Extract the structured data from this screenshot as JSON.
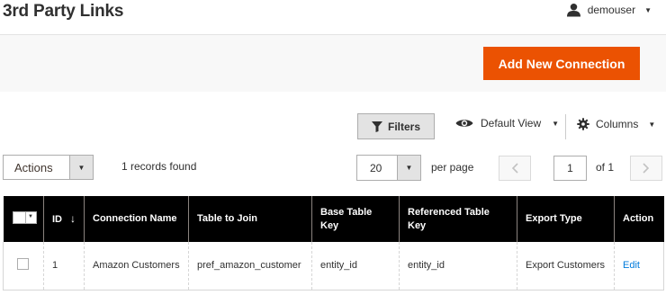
{
  "header": {
    "title": "3rd Party Links",
    "user_name": "demouser"
  },
  "action_bar": {
    "add_button": "Add New Connection"
  },
  "toolbar": {
    "filters_label": "Filters",
    "view_label": "Default View",
    "columns_label": "Columns"
  },
  "grid_controls": {
    "actions_label": "Actions",
    "records_found": "1 records found",
    "per_page_value": "20",
    "per_page_label": "per page",
    "current_page": "1",
    "total_pages": "of 1"
  },
  "table": {
    "columns": [
      "ID",
      "Connection Name",
      "Table to Join",
      "Base Table Key",
      "Referenced Table Key",
      "Export Type",
      "Action"
    ],
    "rows": [
      {
        "id": "1",
        "connection_name": "Amazon Customers",
        "table_to_join": "pref_amazon_customer",
        "base_key": "entity_id",
        "referenced_key": "entity_id",
        "export_type": "Export Customers",
        "action": "Edit"
      }
    ]
  },
  "colors": {
    "accent": "#eb5202",
    "header_bg": "#000000",
    "link": "#007bdb"
  },
  "icons": [
    "user-icon",
    "filter-icon",
    "eye-icon",
    "gear-icon",
    "chevron-left-icon",
    "chevron-right-icon",
    "sort-down-icon"
  ]
}
